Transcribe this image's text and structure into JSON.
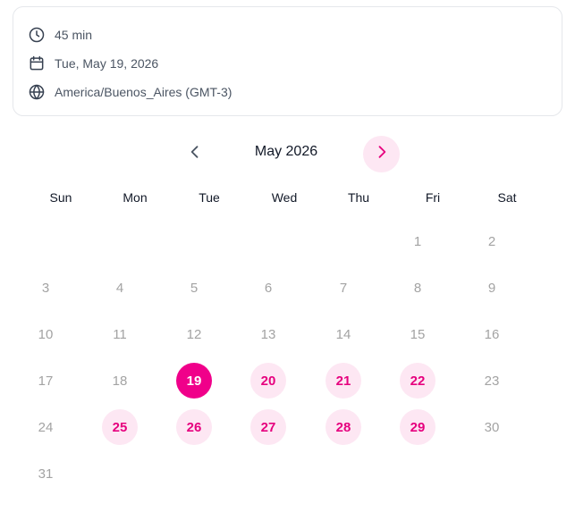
{
  "event": {
    "duration": "45 min",
    "date": "Tue, May 19, 2026",
    "timezone": "America/Buenos_Aires (GMT-3)"
  },
  "calendar": {
    "month_label": "May 2026",
    "weekdays": [
      "Sun",
      "Mon",
      "Tue",
      "Wed",
      "Thu",
      "Fri",
      "Sat"
    ],
    "first_weekday_index": 5,
    "days_in_month": 31,
    "selected_day": 19,
    "available_days": [
      20,
      21,
      22,
      25,
      26,
      27,
      28,
      29
    ]
  },
  "colors": {
    "accent": "#f0008a",
    "accent_soft": "#fde7f3",
    "accent_text": "#e6007e",
    "muted_text": "#a3a3a3"
  },
  "icons": {
    "duration": "clock-icon",
    "date": "calendar-icon",
    "timezone": "globe-icon",
    "prev": "chevron-left-icon",
    "next": "chevron-right-icon"
  }
}
